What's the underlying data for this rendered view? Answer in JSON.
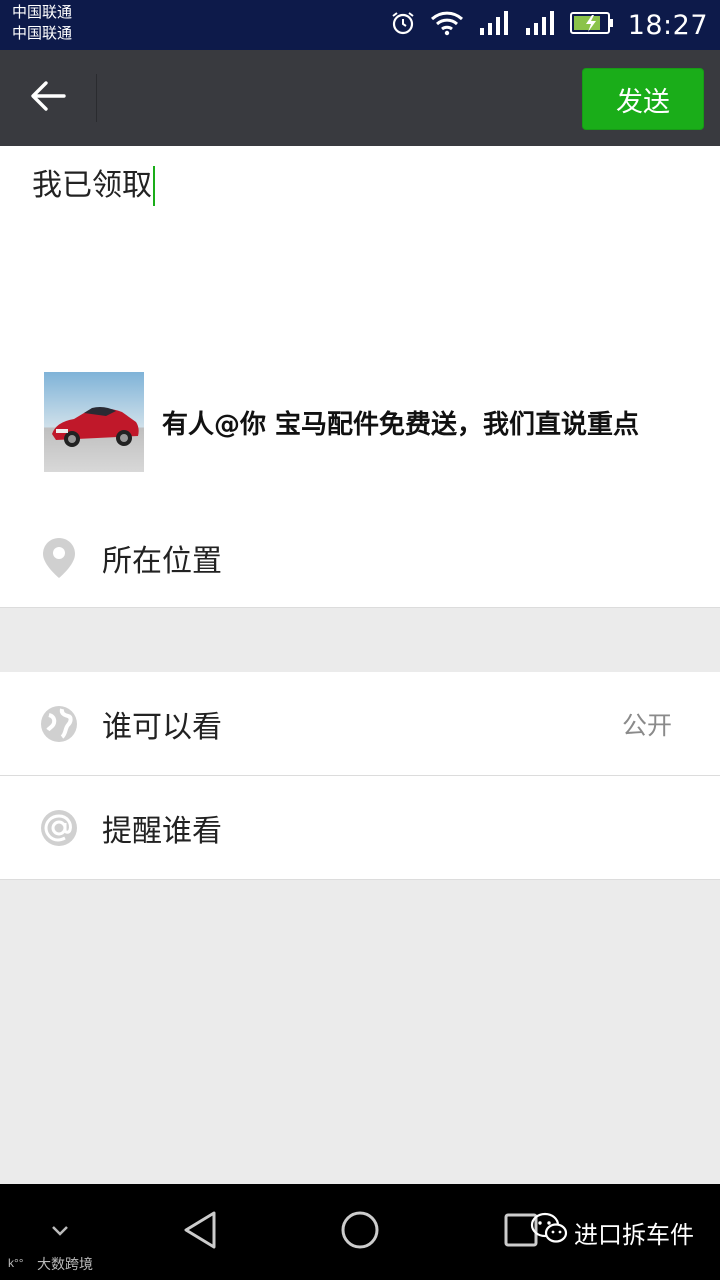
{
  "status_bar": {
    "carrier_1": "中国联通",
    "carrier_2": "中国联通",
    "time": "18:27"
  },
  "title_bar": {
    "back_icon": "arrow-left-icon",
    "send_label": "发送",
    "send_color": "#1aad19"
  },
  "composer": {
    "text": "我已领取",
    "link_card": {
      "thumbnail": "red-car-image",
      "title": "有人@你 宝马配件免费送，我们直说重点"
    },
    "location": {
      "icon": "location-pin-icon",
      "label": "所在位置"
    }
  },
  "options": [
    {
      "icon": "globe-icon",
      "label": "谁可以看",
      "value": "公开"
    },
    {
      "icon": "at-sign-icon",
      "label": "提醒谁看",
      "value": ""
    }
  ],
  "nav_bar": {
    "watermark_left": "大数跨境",
    "watermark_right": "进口拆车件"
  }
}
